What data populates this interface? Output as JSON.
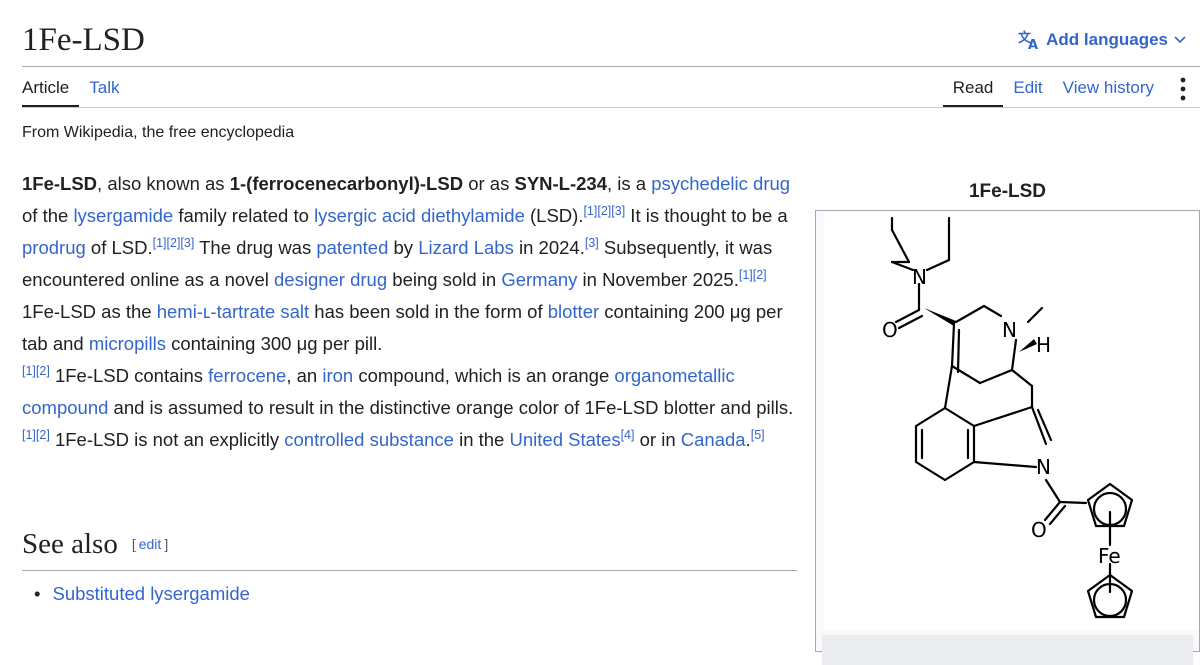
{
  "page": {
    "title": "1Fe-LSD",
    "add_languages": "Add languages",
    "tabs_left": [
      {
        "label": "Article"
      },
      {
        "label": "Talk"
      }
    ],
    "tabs_right": [
      {
        "label": "Read"
      },
      {
        "label": "Edit"
      },
      {
        "label": "View history"
      }
    ],
    "tagline": "From Wikipedia, the free encyclopedia"
  },
  "article": {
    "bold_name": "1Fe-LSD",
    "t1": ", also known as ",
    "alias1": "1-(ferrocenecarbonyl)-LSD",
    "t2": " or as ",
    "alias2": "SYN-L-234",
    "t3": ", is a ",
    "link_psychedelic": "psychedelic drug",
    "t4": " of the ",
    "link_lysergamide": "lysergamide",
    "t5": " family related to ",
    "link_lad": "lysergic acid diethylamide",
    "t6": " (LSD).",
    "t7": " It is thought to be a ",
    "link_prodrug": "prodrug",
    "t8": " of LSD.",
    "t9": " The drug was ",
    "link_patented": "patented",
    "t10": " by ",
    "link_lizard": "Lizard Labs",
    "t11": " in 2024.",
    "t12": " Subsequently, it was encountered online as a novel ",
    "link_designer": "designer drug",
    "t13": " being sold in ",
    "link_germany": "Germany",
    "t14": " in November 2025.",
    "t15": " 1Fe-LSD as the ",
    "link_tartrate": "hemi-ʟ-tartrate salt",
    "t16": " has been sold in the form of ",
    "link_blotter": "blotter",
    "t17": " containing 200 μg per tab and ",
    "link_micropills": "micropills",
    "t18": " containing 300 μg per pill.",
    "t19": " 1Fe-LSD contains ",
    "link_ferrocene": "ferrocene",
    "t20": ", an ",
    "link_iron": "iron",
    "t21": " compound, which is an orange ",
    "link_organometallic": "organometallic compound",
    "t22": " and is assumed to result in the distinctive orange color of 1Fe-LSD blotter and pills.",
    "t23": " 1Fe-LSD is not an explicitly ",
    "link_controlled": "controlled substance",
    "t24": " in the ",
    "link_us": "United States",
    "t25": " or in ",
    "link_canada": "Canada",
    "t26": ".",
    "ref1": "[1]",
    "ref2": "[2]",
    "ref3": "[3]",
    "ref4": "[4]",
    "ref5": "[5]"
  },
  "see_also": {
    "heading": "See also",
    "edit_open": "[",
    "edit_label": "edit",
    "edit_close": "]",
    "items": [
      {
        "label": "Substituted lysergamide"
      }
    ]
  },
  "infobox": {
    "caption": "1Fe-LSD",
    "atom_n_amide": "N",
    "atom_o_amide": "O",
    "atom_n_methyl": "N",
    "atom_h": "H",
    "atom_n_indole": "N",
    "atom_o_carbonyl": "O",
    "atom_fe": "Fe"
  },
  "colors": {
    "link": "#3366cc",
    "text": "#202122",
    "border": "#a2a9b1"
  }
}
